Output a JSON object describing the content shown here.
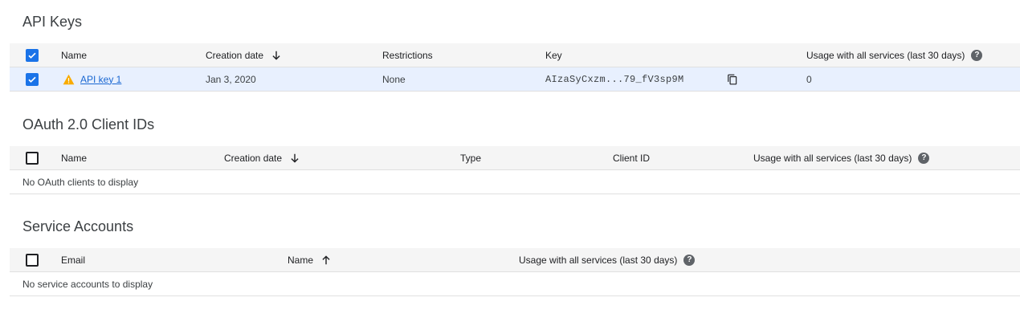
{
  "api_keys": {
    "title": "API Keys",
    "columns": {
      "name": "Name",
      "creation_date": "Creation date",
      "restrictions": "Restrictions",
      "key": "Key",
      "usage": "Usage with all services (last 30 days)"
    },
    "rows": [
      {
        "name": "API key 1",
        "creation_date": "Jan 3, 2020",
        "restrictions": "None",
        "key": "AIzaSyCxzm...79_fV3sp9M",
        "usage": "0"
      }
    ]
  },
  "oauth": {
    "title": "OAuth 2.0 Client IDs",
    "columns": {
      "name": "Name",
      "creation_date": "Creation date",
      "type": "Type",
      "client_id": "Client ID",
      "usage": "Usage with all services (last 30 days)"
    },
    "empty_message": "No OAuth clients to display"
  },
  "service_accounts": {
    "title": "Service Accounts",
    "columns": {
      "email": "Email",
      "name": "Name",
      "usage": "Usage with all services (last 30 days)"
    },
    "empty_message": "No service accounts to display"
  },
  "icons": {
    "sort_desc": "arrow-down-icon",
    "sort_asc": "arrow-up-icon",
    "help": "help-icon",
    "warning": "warning-icon",
    "copy": "copy-icon",
    "checkbox": "checkbox-icon"
  },
  "colors": {
    "accent": "#1a73e8",
    "link": "#1967d2",
    "warning": "#f9ab00",
    "header_bg": "#f5f5f5",
    "selected_row_bg": "#e8f0fe"
  }
}
